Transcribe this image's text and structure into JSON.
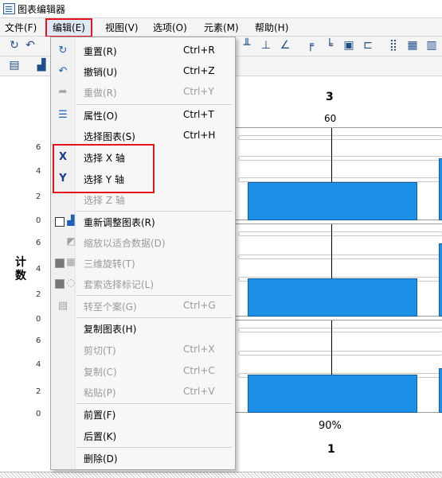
{
  "window": {
    "title": "图表编辑器"
  },
  "menubar": [
    {
      "label": "文件(F)"
    },
    {
      "label": "编辑(E)",
      "active": true
    },
    {
      "label": "视图(V)"
    },
    {
      "label": "选项(O)"
    },
    {
      "label": "元素(M)"
    },
    {
      "label": "帮助(H)"
    }
  ],
  "chart": {
    "panel_title": "3",
    "column_value": "60",
    "y_axis_label": "计数",
    "y_ticks": [
      "6",
      "4",
      "2",
      "0"
    ],
    "bottom_value": "90%",
    "bottom_panel": "1",
    "bar_color": "#1c8fe6"
  },
  "edit_menu": {
    "items": [
      {
        "label": "重置(R)",
        "shortcut": "Ctrl+R",
        "icon": "redo-icon",
        "enabled": true
      },
      {
        "label": "撤销(U)",
        "shortcut": "Ctrl+Z",
        "icon": "undo-icon",
        "enabled": true
      },
      {
        "label": "重做(R)",
        "shortcut": "Ctrl+Y",
        "icon": "redo-arrow-icon",
        "enabled": false
      },
      {
        "label": "属性(O)",
        "shortcut": "Ctrl+T",
        "icon": "properties-icon",
        "enabled": true
      },
      {
        "label": "选择图表(S)",
        "shortcut": "Ctrl+H",
        "icon": "",
        "enabled": true
      },
      {
        "label": "选择 X 轴",
        "shortcut": "",
        "icon": "x-axis-icon",
        "enabled": true
      },
      {
        "label": "选择 Y 轴",
        "shortcut": "",
        "icon": "y-axis-icon",
        "enabled": true
      },
      {
        "label": "选择 Z 轴",
        "shortcut": "",
        "icon": "",
        "enabled": false
      },
      {
        "label": "重新调整图表(R)",
        "shortcut": "",
        "icon": "rescale-chart-icon",
        "enabled": true
      },
      {
        "label": "缩放以适合数据(D)",
        "shortcut": "",
        "icon": "scale-to-data-icon",
        "enabled": false
      },
      {
        "label": "三维旋转(T)",
        "shortcut": "",
        "icon": "3d-rotate-icon",
        "enabled": false
      },
      {
        "label": "套索选择标记(L)",
        "shortcut": "",
        "icon": "lasso-icon",
        "enabled": false
      },
      {
        "label": "转至个案(G)",
        "shortcut": "Ctrl+G",
        "icon": "goto-case-icon",
        "enabled": false
      },
      {
        "label": "复制图表(H)",
        "shortcut": "",
        "icon": "",
        "enabled": true
      },
      {
        "label": "剪切(T)",
        "shortcut": "Ctrl+X",
        "icon": "",
        "enabled": false
      },
      {
        "label": "复制(C)",
        "shortcut": "Ctrl+C",
        "icon": "",
        "enabled": false
      },
      {
        "label": "粘贴(P)",
        "shortcut": "Ctrl+V",
        "icon": "",
        "enabled": false
      },
      {
        "label": "前置(F)",
        "shortcut": "",
        "icon": "",
        "enabled": true
      },
      {
        "label": "后置(K)",
        "shortcut": "",
        "icon": "",
        "enabled": true
      },
      {
        "label": "删除(D)",
        "shortcut": "",
        "icon": "",
        "enabled": true
      }
    ]
  }
}
